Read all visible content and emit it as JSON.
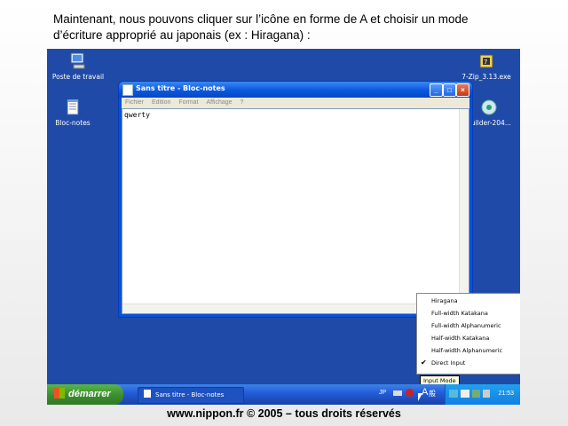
{
  "caption": "Maintenant, nous pouvons cliquer sur l’icône en forme de A et choisir un mode d’écriture approprié au japonais (ex : Hiragana) :",
  "footer": "www.nippon.fr © 2005 – tous droits réservés",
  "desktop": {
    "icons": [
      {
        "label": "Poste de travail"
      },
      {
        "label": "Bloc-notes"
      },
      {
        "label": "7-Zip_3.13.exe"
      },
      {
        "label": "builder-204..."
      }
    ]
  },
  "window": {
    "title": "Sans titre - Bloc-notes",
    "menu": [
      "Fichier",
      "Edition",
      "Format",
      "Affichage",
      "?"
    ],
    "content": "qwerty"
  },
  "ime_menu": {
    "items": [
      "Hiragana",
      "Full-width Katakana",
      "Full-width Alphanumeric",
      "Half-width Katakana",
      "Half-width Alphanumeric",
      "Direct Input"
    ],
    "checked": "Direct Input",
    "tooltip": "Input Mode"
  },
  "taskbar": {
    "start_label": "démarrer",
    "task": "Sans titre - Bloc-notes",
    "lang": "JP",
    "ime_a": "A",
    "ime_mode": "般",
    "clock": "21:53"
  }
}
